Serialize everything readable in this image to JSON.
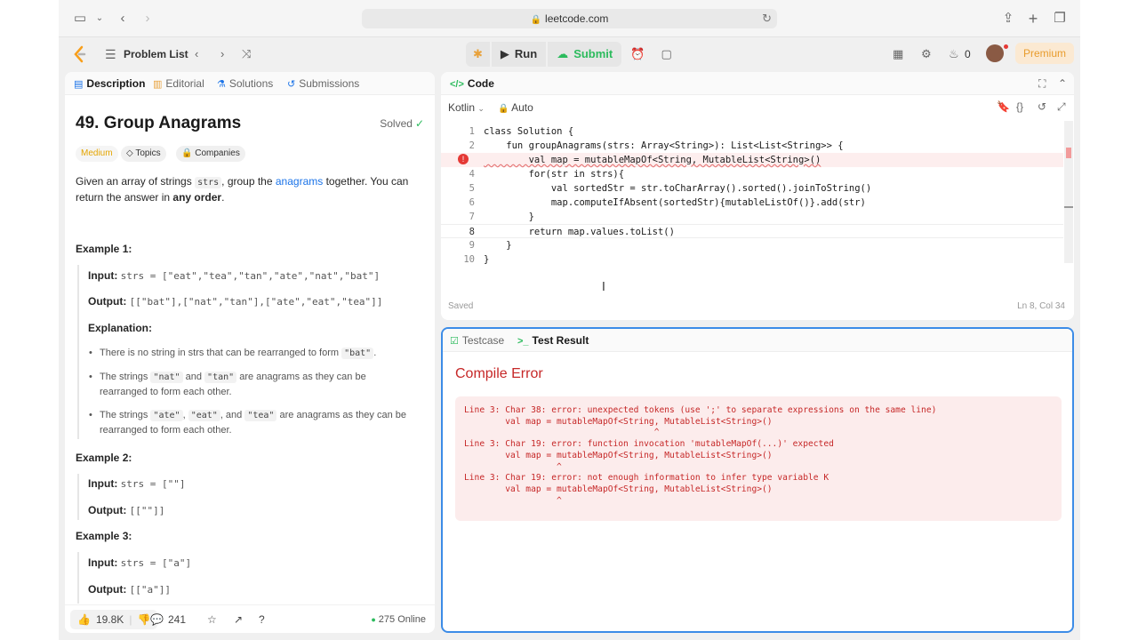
{
  "browser": {
    "url": "leetcode.com"
  },
  "nav": {
    "problem_list": "Problem List",
    "run": "Run",
    "submit": "Submit",
    "streak_count": "0",
    "premium": "Premium"
  },
  "left_tabs": [
    "Description",
    "Editorial",
    "Solutions",
    "Submissions"
  ],
  "problem": {
    "title": "49. Group Anagrams",
    "solved": "Solved",
    "difficulty": "Medium",
    "topics": "Topics",
    "companies": "Companies",
    "statement_1": "Given an array of strings ",
    "statement_code": "strs",
    "statement_2": ", group the ",
    "statement_link": "anagrams",
    "statement_3": " together. You can",
    "statement_4": "return the answer in ",
    "statement_bold": "any order",
    "statement_5": "."
  },
  "examples": [
    {
      "heading": "Example 1:",
      "input_label": "Input:",
      "input": "strs = [\"eat\",\"tea\",\"tan\",\"ate\",\"nat\",\"bat\"]",
      "output_label": "Output:",
      "output": "[[\"bat\"],[\"nat\",\"tan\"],[\"ate\",\"eat\",\"tea\"]]",
      "explanation_label": "Explanation:",
      "bullet_1a": "There is no string in strs that can be rearranged to form ",
      "bullet_1code": "\"bat\"",
      "bullet_1b": ".",
      "bullet_2a": "The strings ",
      "bullet_2code1": "\"nat\"",
      "bullet_2b": " and ",
      "bullet_2code2": "\"tan\"",
      "bullet_2c": " are anagrams as they can be",
      "bullet_2d": "rearranged to form each other.",
      "bullet_3a": "The strings ",
      "bullet_3code1": "\"ate\"",
      "bullet_3b": ", ",
      "bullet_3code2": "\"eat\"",
      "bullet_3c": ", and ",
      "bullet_3code3": "\"tea\"",
      "bullet_3d": " are anagrams as they can be",
      "bullet_3e": "rearranged to form each other."
    },
    {
      "heading": "Example 2:",
      "input_label": "Input:",
      "input": "strs = [\"\"]",
      "output_label": "Output:",
      "output": "[[\"\"]]"
    },
    {
      "heading": "Example 3:",
      "input_label": "Input:",
      "input": "strs = [\"a\"]",
      "output_label": "Output:",
      "output": "[[\"a\"]]"
    }
  ],
  "footer": {
    "likes": "19.8K",
    "comments": "241",
    "online": "275 Online"
  },
  "code_panel": {
    "title": "Code",
    "language": "Kotlin",
    "mode": "Auto",
    "status": "Saved",
    "cursor": "Ln 8, Col 34",
    "lines": [
      "class Solution {",
      "    fun groupAnagrams(strs: Array<String>): List<List<String>> {",
      "        val map = mutableMapOf<String, MutableList<String>()",
      "        for(str in strs){",
      "            val sortedStr = str.toCharArray().sorted().joinToString()",
      "            map.computeIfAbsent(sortedStr){mutableListOf()}.add(str)",
      "        }",
      "        return map.values.toList()",
      "    }",
      "}"
    ]
  },
  "result_panel": {
    "tab_testcase": "Testcase",
    "tab_result": "Test Result",
    "error_title": "Compile Error",
    "error_text": "Line 3: Char 38: error: unexpected tokens (use ';' to separate expressions on the same line)\n        val map = mutableMapOf<String, MutableList<String>()\n                                     ^\nLine 3: Char 19: error: function invocation 'mutableMapOf(...)' expected\n        val map = mutableMapOf<String, MutableList<String>()\n                  ^\nLine 3: Char 19: error: not enough information to infer type variable K\n        val map = mutableMapOf<String, MutableList<String>()\n                  ^"
  }
}
